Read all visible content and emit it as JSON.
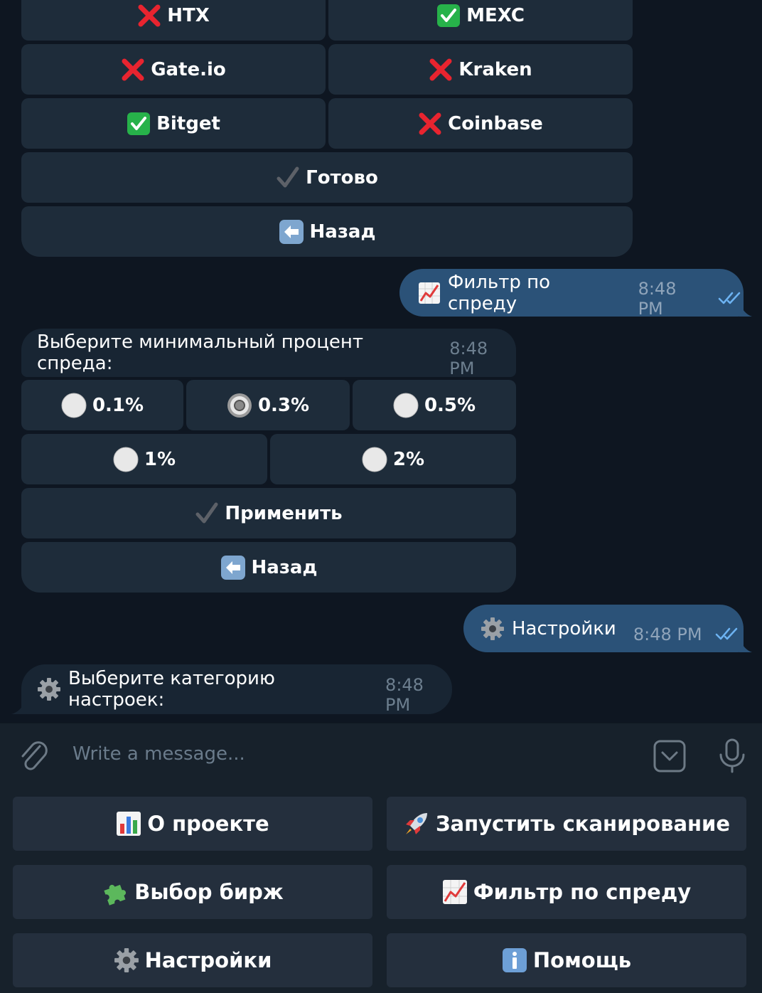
{
  "exchange_keyboard": {
    "htx": {
      "status": "off",
      "label": "HTX"
    },
    "mexc": {
      "status": "on",
      "label": "MEXC"
    },
    "gate": {
      "status": "off",
      "label": "Gate.io"
    },
    "kraken": {
      "status": "off",
      "label": "Kraken"
    },
    "bitget": {
      "status": "on",
      "label": "Bitget"
    },
    "coinbase": {
      "status": "off",
      "label": "Coinbase"
    },
    "done_label": "Готово",
    "back_label": "Назад"
  },
  "messages": {
    "out1": {
      "text": "Фильтр по спреду",
      "time": "8:48 PM"
    },
    "in1": {
      "text": "Выберите минимальный процент спреда:",
      "time": "8:48 PM"
    },
    "out2": {
      "text": "Настройки",
      "time": "8:48 PM"
    },
    "in2": {
      "text": "Выберите категорию настроек:",
      "time": "8:48 PM"
    }
  },
  "spread_keyboard": {
    "options": [
      {
        "label": "0.1%",
        "selected": false
      },
      {
        "label": "0.3%",
        "selected": true
      },
      {
        "label": "0.5%",
        "selected": false
      },
      {
        "label": "1%",
        "selected": false
      },
      {
        "label": "2%",
        "selected": false
      }
    ],
    "apply_label": "Применить",
    "back_label": "Назад"
  },
  "input": {
    "placeholder": "Write a message..."
  },
  "reply_keyboard": {
    "about": "О проекте",
    "start_scan": "Запустить сканирование",
    "exchanges": "Выбор бирж",
    "spread_filter": "Фильтр по спреду",
    "settings": "Настройки",
    "help": "Помощь"
  },
  "colors": {
    "chat_bg": "#0e1621",
    "incoming_bubble": "#182533",
    "outgoing_bubble": "#2b5278",
    "inline_button": "#1e2c3a",
    "panel": "#17212b",
    "reply_button": "#242f3d",
    "check_green": "#27b24a",
    "cross_red": "#e8242f"
  }
}
